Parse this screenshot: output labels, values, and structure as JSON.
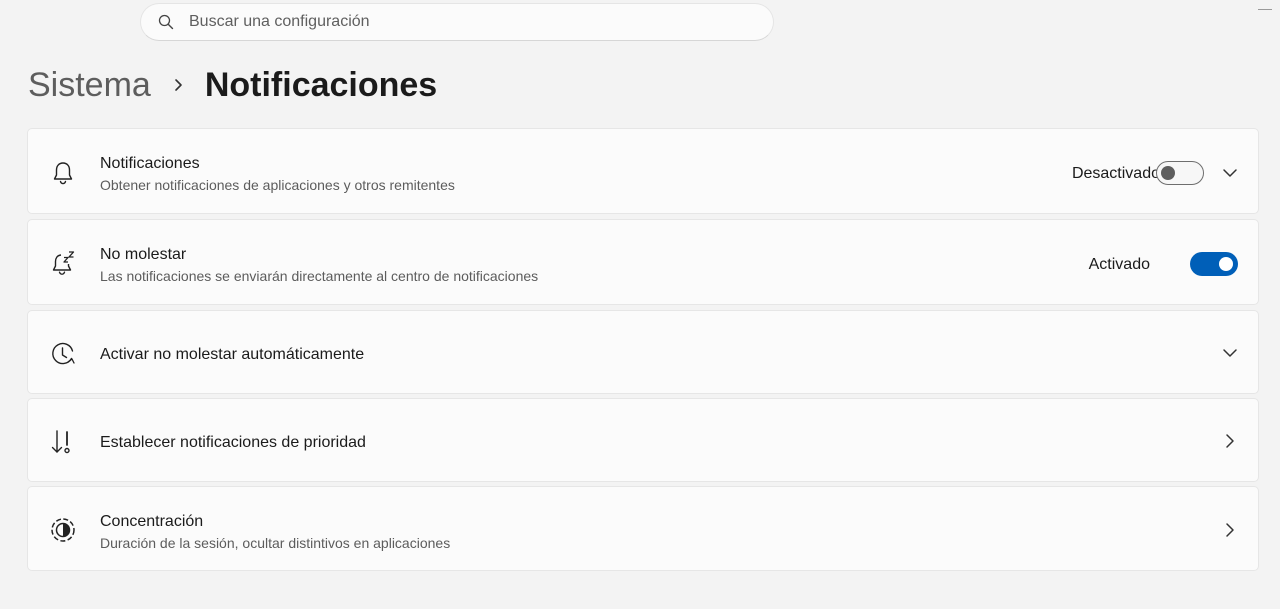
{
  "search": {
    "placeholder": "Buscar una configuración",
    "icon": "search-icon"
  },
  "breadcrumb": {
    "parent": "Sistema",
    "current": "Notificaciones"
  },
  "settings": [
    {
      "icon": "bell-icon",
      "title": "Notificaciones",
      "subtitle": "Obtener notificaciones de aplicaciones y otros remitentes",
      "state_label": "Desactivado",
      "toggle_on": false,
      "control": "chevron-down"
    },
    {
      "icon": "bell-snooze-icon",
      "title": "No molestar",
      "subtitle": "Las notificaciones se enviarán directamente al centro de notificaciones",
      "state_label": "Activado",
      "toggle_on": true,
      "control": "none"
    },
    {
      "icon": "clock-icon",
      "title": "Activar no molestar automáticamente",
      "control": "chevron-down"
    },
    {
      "icon": "priority-arrow-icon",
      "title": "Establecer notificaciones de prioridad",
      "control": "chevron-right"
    },
    {
      "icon": "focus-icon",
      "title": "Concentración",
      "subtitle": "Duración de la sesión, ocultar distintivos en aplicaciones",
      "control": "chevron-right"
    }
  ],
  "colors": {
    "background": "#f3f3f3",
    "card": "#fbfbfb",
    "accent": "#005fb8"
  }
}
